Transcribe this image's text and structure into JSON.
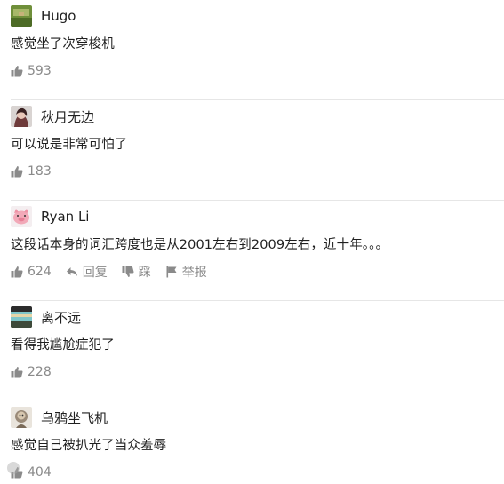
{
  "comments": [
    {
      "username": "Hugo",
      "avatar_icon": "green-field-avatar-icon",
      "text": "感觉坐了次穿梭机",
      "likes": "593"
    },
    {
      "username": "秋月无边",
      "avatar_icon": "portrait-avatar-icon",
      "text": "可以说是非常可怕了",
      "likes": "183"
    },
    {
      "username": "Ryan Li",
      "avatar_icon": "pink-pig-avatar-icon",
      "text": "这段话本身的词汇跨度也是从2001左右到2009左右，近十年。。。",
      "likes": "624",
      "reply_label": "回复",
      "dislike_label": "踩",
      "report_label": "举报"
    },
    {
      "username": "离不远",
      "avatar_icon": "landscape-avatar-icon",
      "text": "看得我尴尬症犯了",
      "likes": "228"
    },
    {
      "username": "乌鸦坐飞机",
      "avatar_icon": "crow-avatar-icon",
      "text": "感觉自己被扒光了当众羞辱",
      "likes": "404"
    }
  ],
  "colors": {
    "text": "#1f1f1f",
    "meta": "#8a8a8a",
    "divider": "#e6e6e6"
  }
}
